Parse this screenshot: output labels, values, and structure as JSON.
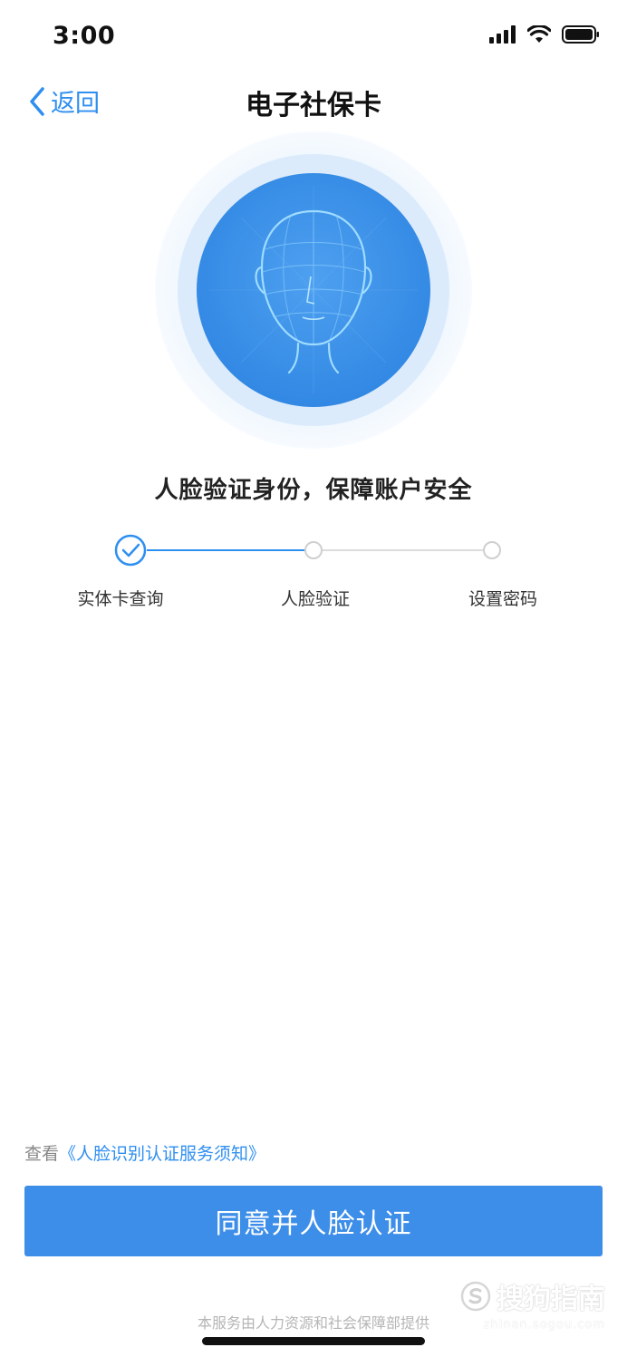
{
  "status_bar": {
    "time": "3:00"
  },
  "nav": {
    "back_label": "返回",
    "title": "电子社保卡"
  },
  "headline": "人脸验证身份，保障账户安全",
  "steps": [
    {
      "label": "实体卡查询",
      "state": "done"
    },
    {
      "label": "人脸验证",
      "state": "pending"
    },
    {
      "label": "设置密码",
      "state": "pending"
    }
  ],
  "notice": {
    "prefix": "查看",
    "link": "《人脸识别认证服务须知》"
  },
  "agree_button": "同意并人脸认证",
  "provider_text": "本服务由人力资源和社会保障部提供",
  "watermark": {
    "brand": "搜狗指南",
    "url": "zhinan.sogou.com"
  },
  "colors": {
    "accent": "#3d8ee9",
    "link": "#2f8ff0",
    "face_bg": "#3a8ee6"
  }
}
